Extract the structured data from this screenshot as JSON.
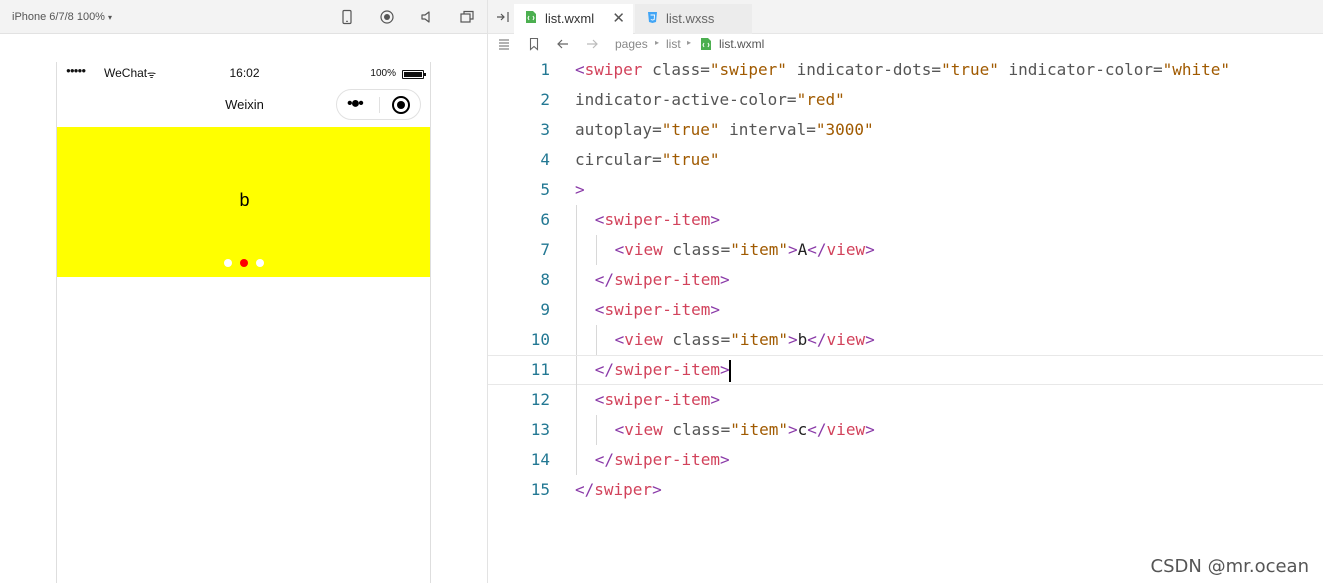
{
  "simulator": {
    "device_label": "iPhone 6/7/8 100%",
    "device_caret": "▾",
    "toolbar_icons": [
      "phone-icon",
      "record-icon",
      "volume-icon",
      "window-icon"
    ],
    "status": {
      "signal": "●●●●●",
      "carrier": "WeChat",
      "wifi": "ᯤ",
      "time": "16:02",
      "battery": "100%"
    },
    "nav_title": "Weixin",
    "capsule_menu": "•●•",
    "swiper": {
      "text": "b",
      "background": "#ffff00",
      "dots": [
        {
          "color": "#ffffff",
          "active": false
        },
        {
          "color": "#ff0000",
          "active": true
        },
        {
          "color": "#ffffff",
          "active": false
        }
      ]
    }
  },
  "editor": {
    "tabs": [
      {
        "label": "list.wxml",
        "close": "✕",
        "active": true,
        "icon": "wxml-file-icon",
        "icon_color": "#4caf50"
      },
      {
        "label": "list.wxss",
        "active": false,
        "icon": "wxss-file-icon",
        "icon_color": "#42a5f5"
      }
    ],
    "breadcrumb": [
      "pages",
      "list",
      "list.wxml"
    ],
    "breadcrumb_sep": "▸",
    "current_line": 11,
    "lines": [
      {
        "n": "1",
        "indent": 0,
        "tokens": [
          [
            "<",
            "br"
          ],
          [
            "swiper",
            "name"
          ],
          [
            " class=",
            "attr"
          ],
          [
            "\"swiper\"",
            "str"
          ],
          [
            " indicator-dots=",
            "attr"
          ],
          [
            "\"true\"",
            "str"
          ],
          [
            " indicator-color=",
            "attr"
          ],
          [
            "\"white\"",
            "str"
          ]
        ]
      },
      {
        "n": "2",
        "indent": 0,
        "tokens": [
          [
            "indicator-active-color=",
            "attr"
          ],
          [
            "\"red\"",
            "str"
          ]
        ]
      },
      {
        "n": "3",
        "indent": 0,
        "tokens": [
          [
            "autoplay=",
            "attr"
          ],
          [
            "\"true\"",
            "str"
          ],
          [
            " interval=",
            "attr"
          ],
          [
            "\"3000\"",
            "str"
          ]
        ]
      },
      {
        "n": "4",
        "indent": 0,
        "tokens": [
          [
            "circular=",
            "attr"
          ],
          [
            "\"true\"",
            "str"
          ]
        ]
      },
      {
        "n": "5",
        "indent": 0,
        "tokens": [
          [
            ">",
            "br"
          ]
        ]
      },
      {
        "n": "6",
        "indent": 1,
        "tokens": [
          [
            "<",
            "br"
          ],
          [
            "swiper-item",
            "name"
          ],
          [
            ">",
            "br"
          ]
        ]
      },
      {
        "n": "7",
        "indent": 2,
        "tokens": [
          [
            "<",
            "br"
          ],
          [
            "view",
            "name"
          ],
          [
            " class=",
            "attr"
          ],
          [
            "\"item\"",
            "str"
          ],
          [
            ">",
            "br"
          ],
          [
            "A",
            "txt"
          ],
          [
            "</",
            "br"
          ],
          [
            "view",
            "name"
          ],
          [
            ">",
            "br"
          ]
        ]
      },
      {
        "n": "8",
        "indent": 1,
        "tokens": [
          [
            "</",
            "br"
          ],
          [
            "swiper-item",
            "name"
          ],
          [
            ">",
            "br"
          ]
        ]
      },
      {
        "n": "9",
        "indent": 1,
        "tokens": [
          [
            "<",
            "br"
          ],
          [
            "swiper-item",
            "name"
          ],
          [
            ">",
            "br"
          ]
        ]
      },
      {
        "n": "10",
        "indent": 2,
        "tokens": [
          [
            "<",
            "br"
          ],
          [
            "view",
            "name"
          ],
          [
            " class=",
            "attr"
          ],
          [
            "\"item\"",
            "str"
          ],
          [
            ">",
            "br"
          ],
          [
            "b",
            "txt"
          ],
          [
            "</",
            "br"
          ],
          [
            "view",
            "name"
          ],
          [
            ">",
            "br"
          ]
        ]
      },
      {
        "n": "11",
        "indent": 1,
        "tokens": [
          [
            "</",
            "br"
          ],
          [
            "swiper-item",
            "name"
          ],
          [
            ">",
            "br"
          ]
        ]
      },
      {
        "n": "12",
        "indent": 1,
        "tokens": [
          [
            "<",
            "br"
          ],
          [
            "swiper-item",
            "name"
          ],
          [
            ">",
            "br"
          ]
        ]
      },
      {
        "n": "13",
        "indent": 2,
        "tokens": [
          [
            "<",
            "br"
          ],
          [
            "view",
            "name"
          ],
          [
            " class=",
            "attr"
          ],
          [
            "\"item\"",
            "str"
          ],
          [
            ">",
            "br"
          ],
          [
            "c",
            "txt"
          ],
          [
            "</",
            "br"
          ],
          [
            "view",
            "name"
          ],
          [
            ">",
            "br"
          ]
        ]
      },
      {
        "n": "14",
        "indent": 1,
        "tokens": [
          [
            "</",
            "br"
          ],
          [
            "swiper-item",
            "name"
          ],
          [
            ">",
            "br"
          ]
        ]
      },
      {
        "n": "15",
        "indent": 0,
        "tokens": [
          [
            "</",
            "br"
          ],
          [
            "swiper",
            "name"
          ],
          [
            ">",
            "br"
          ]
        ]
      }
    ]
  },
  "watermark": "CSDN @mr.ocean"
}
